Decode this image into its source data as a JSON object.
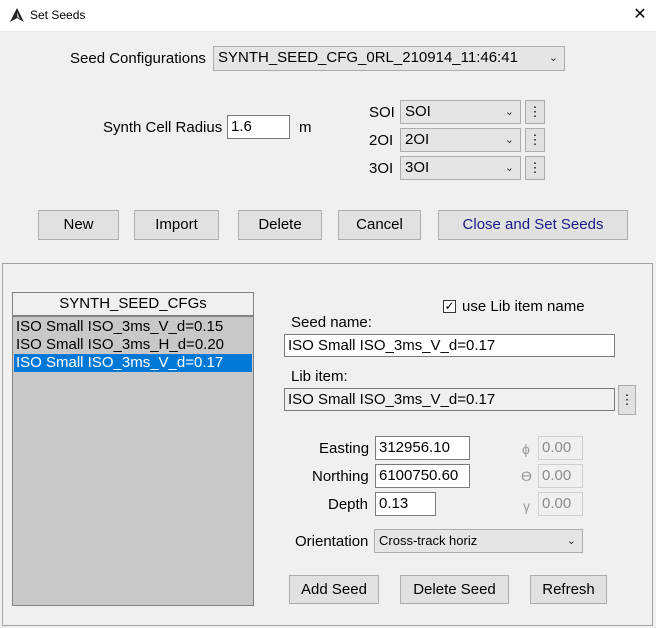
{
  "window": {
    "title": "Set Seeds",
    "close_glyph": "✕"
  },
  "config": {
    "seed_configurations_label": "Seed Configurations",
    "seed_configuration_value": "SYNTH_SEED_CFG_0RL_210914_11:46:41",
    "synth_cell_radius_label": "Synth Cell Radius",
    "synth_cell_radius_value": "1.6",
    "radius_unit": "m",
    "soi_label": "SOI",
    "soi_value": "SOI",
    "oi2_label": "2OI",
    "oi2_value": "2OI",
    "oi3_label": "3OI",
    "oi3_value": "3OI"
  },
  "buttons": {
    "new": "New",
    "import": "Import",
    "delete": "Delete",
    "cancel": "Cancel",
    "close_and_set": "Close and Set Seeds",
    "ellipsis": "⋮",
    "add_seed": "Add Seed",
    "delete_seed": "Delete Seed",
    "refresh": "Refresh"
  },
  "list": {
    "header": "SYNTH_SEED_CFGs",
    "items": [
      "ISO Small ISO_3ms_V_d=0.15",
      "ISO Small ISO_3ms_H_d=0.20",
      "ISO Small ISO_3ms_V_d=0.17"
    ],
    "selected_index": 2
  },
  "seed": {
    "use_lib_label": "use Lib item name",
    "use_lib_checked": true,
    "seed_name_label": "Seed name:",
    "seed_name_value": "ISO Small ISO_3ms_V_d=0.17",
    "lib_item_label": "Lib item:",
    "lib_item_value": "ISO Small ISO_3ms_V_d=0.17",
    "easting_label": "Easting",
    "easting_value": "312956.10",
    "northing_label": "Northing",
    "northing_value": "6100750.60",
    "depth_label": "Depth",
    "depth_value": "0.13",
    "phi_glyph": "ϕ",
    "phi_value": "0.00",
    "theta_glyph": "ϴ",
    "theta_value": "0.00",
    "gamma_glyph": "γ",
    "gamma_value": "0.00",
    "orientation_label": "Orientation",
    "orientation_value": "Cross-track horiz"
  },
  "icons": {
    "app": "app-logo-icon",
    "chevron": "chevron-down-icon",
    "check": "✓"
  }
}
